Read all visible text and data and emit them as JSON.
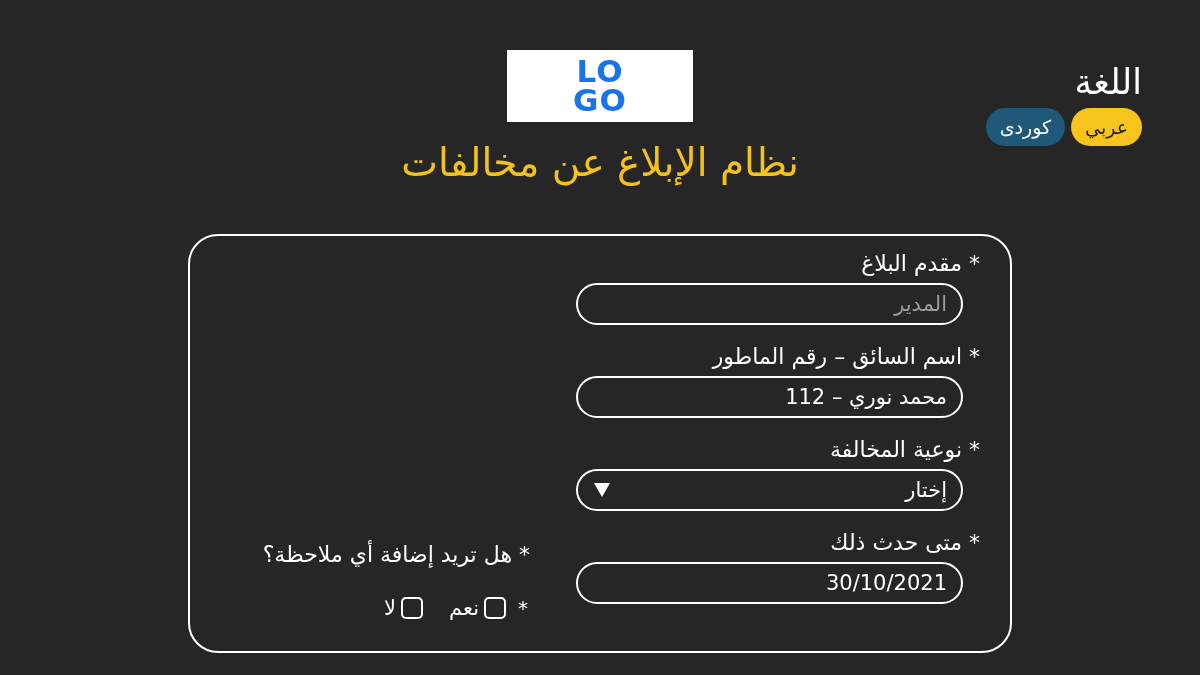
{
  "logo": {
    "lines": [
      "LO",
      "GO"
    ]
  },
  "title": "نظام الإبلاغ عن مخالفات",
  "language": {
    "label": "اللغة",
    "options": [
      {
        "label": "عربي",
        "selected": true
      },
      {
        "label": "كوردى",
        "selected": false
      }
    ]
  },
  "form": {
    "fields": [
      {
        "kind": "text",
        "label": "* مقدم البلاغ",
        "placeholder": "المدير"
      },
      {
        "kind": "text",
        "label": "* اسم السائق – رقم الماطور",
        "value": "محمد نوري – 112"
      },
      {
        "kind": "select",
        "label": "* نوعية المخالفة",
        "value": "إختار"
      },
      {
        "kind": "date",
        "label": "* متى حدث ذلك",
        "value": "30/10/2021"
      }
    ],
    "question": {
      "label": "* هل تريد إضافة أي ملاحظة؟",
      "mark": "*",
      "options": [
        {
          "label": "نعم",
          "checked": false
        },
        {
          "label": "لا",
          "checked": false
        }
      ]
    }
  }
}
